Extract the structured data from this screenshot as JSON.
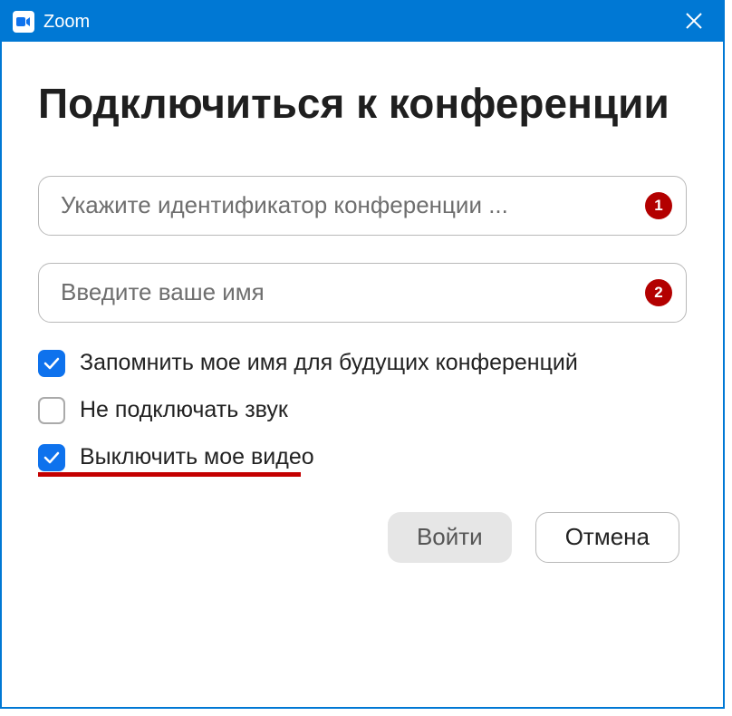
{
  "window": {
    "title": "Zoom"
  },
  "heading": "Подключиться к конференции",
  "fields": {
    "meeting_id": {
      "placeholder": "Укажите идентификатор конференции ...",
      "badge": "1"
    },
    "name": {
      "placeholder": "Введите ваше имя",
      "badge": "2"
    }
  },
  "checkboxes": {
    "remember_name": {
      "label": "Запомнить мое имя для будущих конференций",
      "checked": true
    },
    "no_audio": {
      "label": "Не подключать звук",
      "checked": false
    },
    "disable_video": {
      "label": "Выключить мое видео",
      "checked": true
    }
  },
  "buttons": {
    "join": "Войти",
    "cancel": "Отмена"
  }
}
